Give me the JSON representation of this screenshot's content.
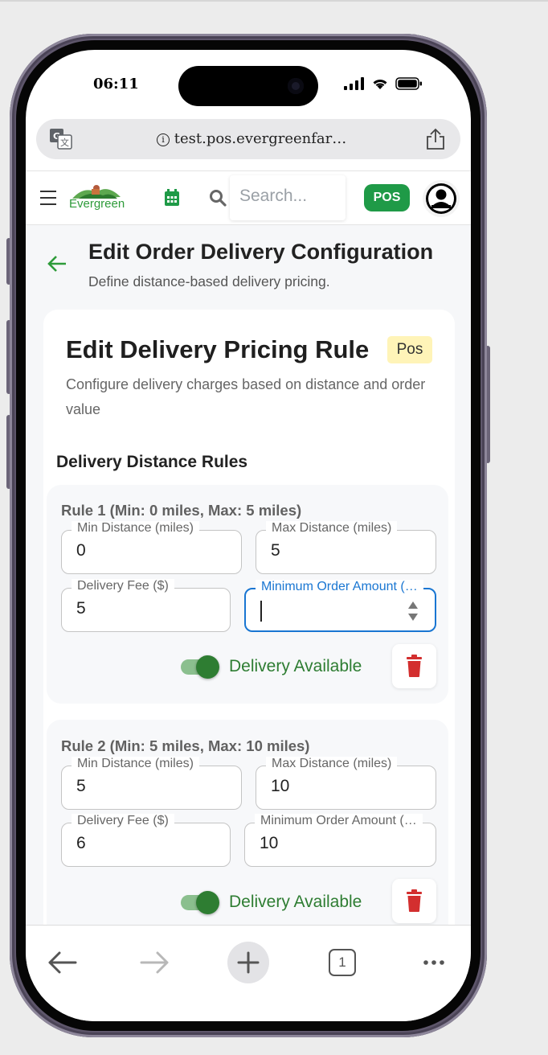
{
  "status_bar": {
    "time": "06:11"
  },
  "browser": {
    "url": "test.pos.evergreenfar…"
  },
  "app_header": {
    "logo_text": "Evergreen",
    "search_placeholder": "Search...",
    "pos_badge": "POS"
  },
  "page": {
    "title": "Edit Order Delivery Configuration",
    "subtitle": "Define distance-based delivery pricing."
  },
  "card": {
    "title": "Edit Delivery Pricing Rule",
    "badge": "Pos",
    "description": "Configure delivery charges based on distance and order value",
    "section_title": "Delivery Distance Rules"
  },
  "rules": [
    {
      "title": "Rule 1 (Min: 0 miles, Max: 5 miles)",
      "min_label": "Min Distance (miles)",
      "min_value": "0",
      "max_label": "Max Distance (miles)",
      "max_value": "5",
      "fee_label": "Delivery Fee ($)",
      "fee_value": "5",
      "min_order_label": "Minimum Order Amount (…",
      "min_order_value": "",
      "toggle_label": "Delivery Available",
      "toggle_on": true
    },
    {
      "title": "Rule 2 (Min: 5 miles, Max: 10 miles)",
      "min_label": "Min Distance (miles)",
      "min_value": "5",
      "max_label": "Max Distance (miles)",
      "max_value": "10",
      "fee_label": "Delivery Fee ($)",
      "fee_value": "6",
      "min_order_label": "Minimum Order Amount (…",
      "min_order_value": "10",
      "toggle_label": "Delivery Available",
      "toggle_on": true
    }
  ],
  "bottom_bar": {
    "tab_count": "1"
  },
  "colors": {
    "brand_green": "#1f9a47",
    "toggle_green": "#2e7d32",
    "focus_blue": "#1976d2",
    "delete_red": "#d32f2f"
  }
}
